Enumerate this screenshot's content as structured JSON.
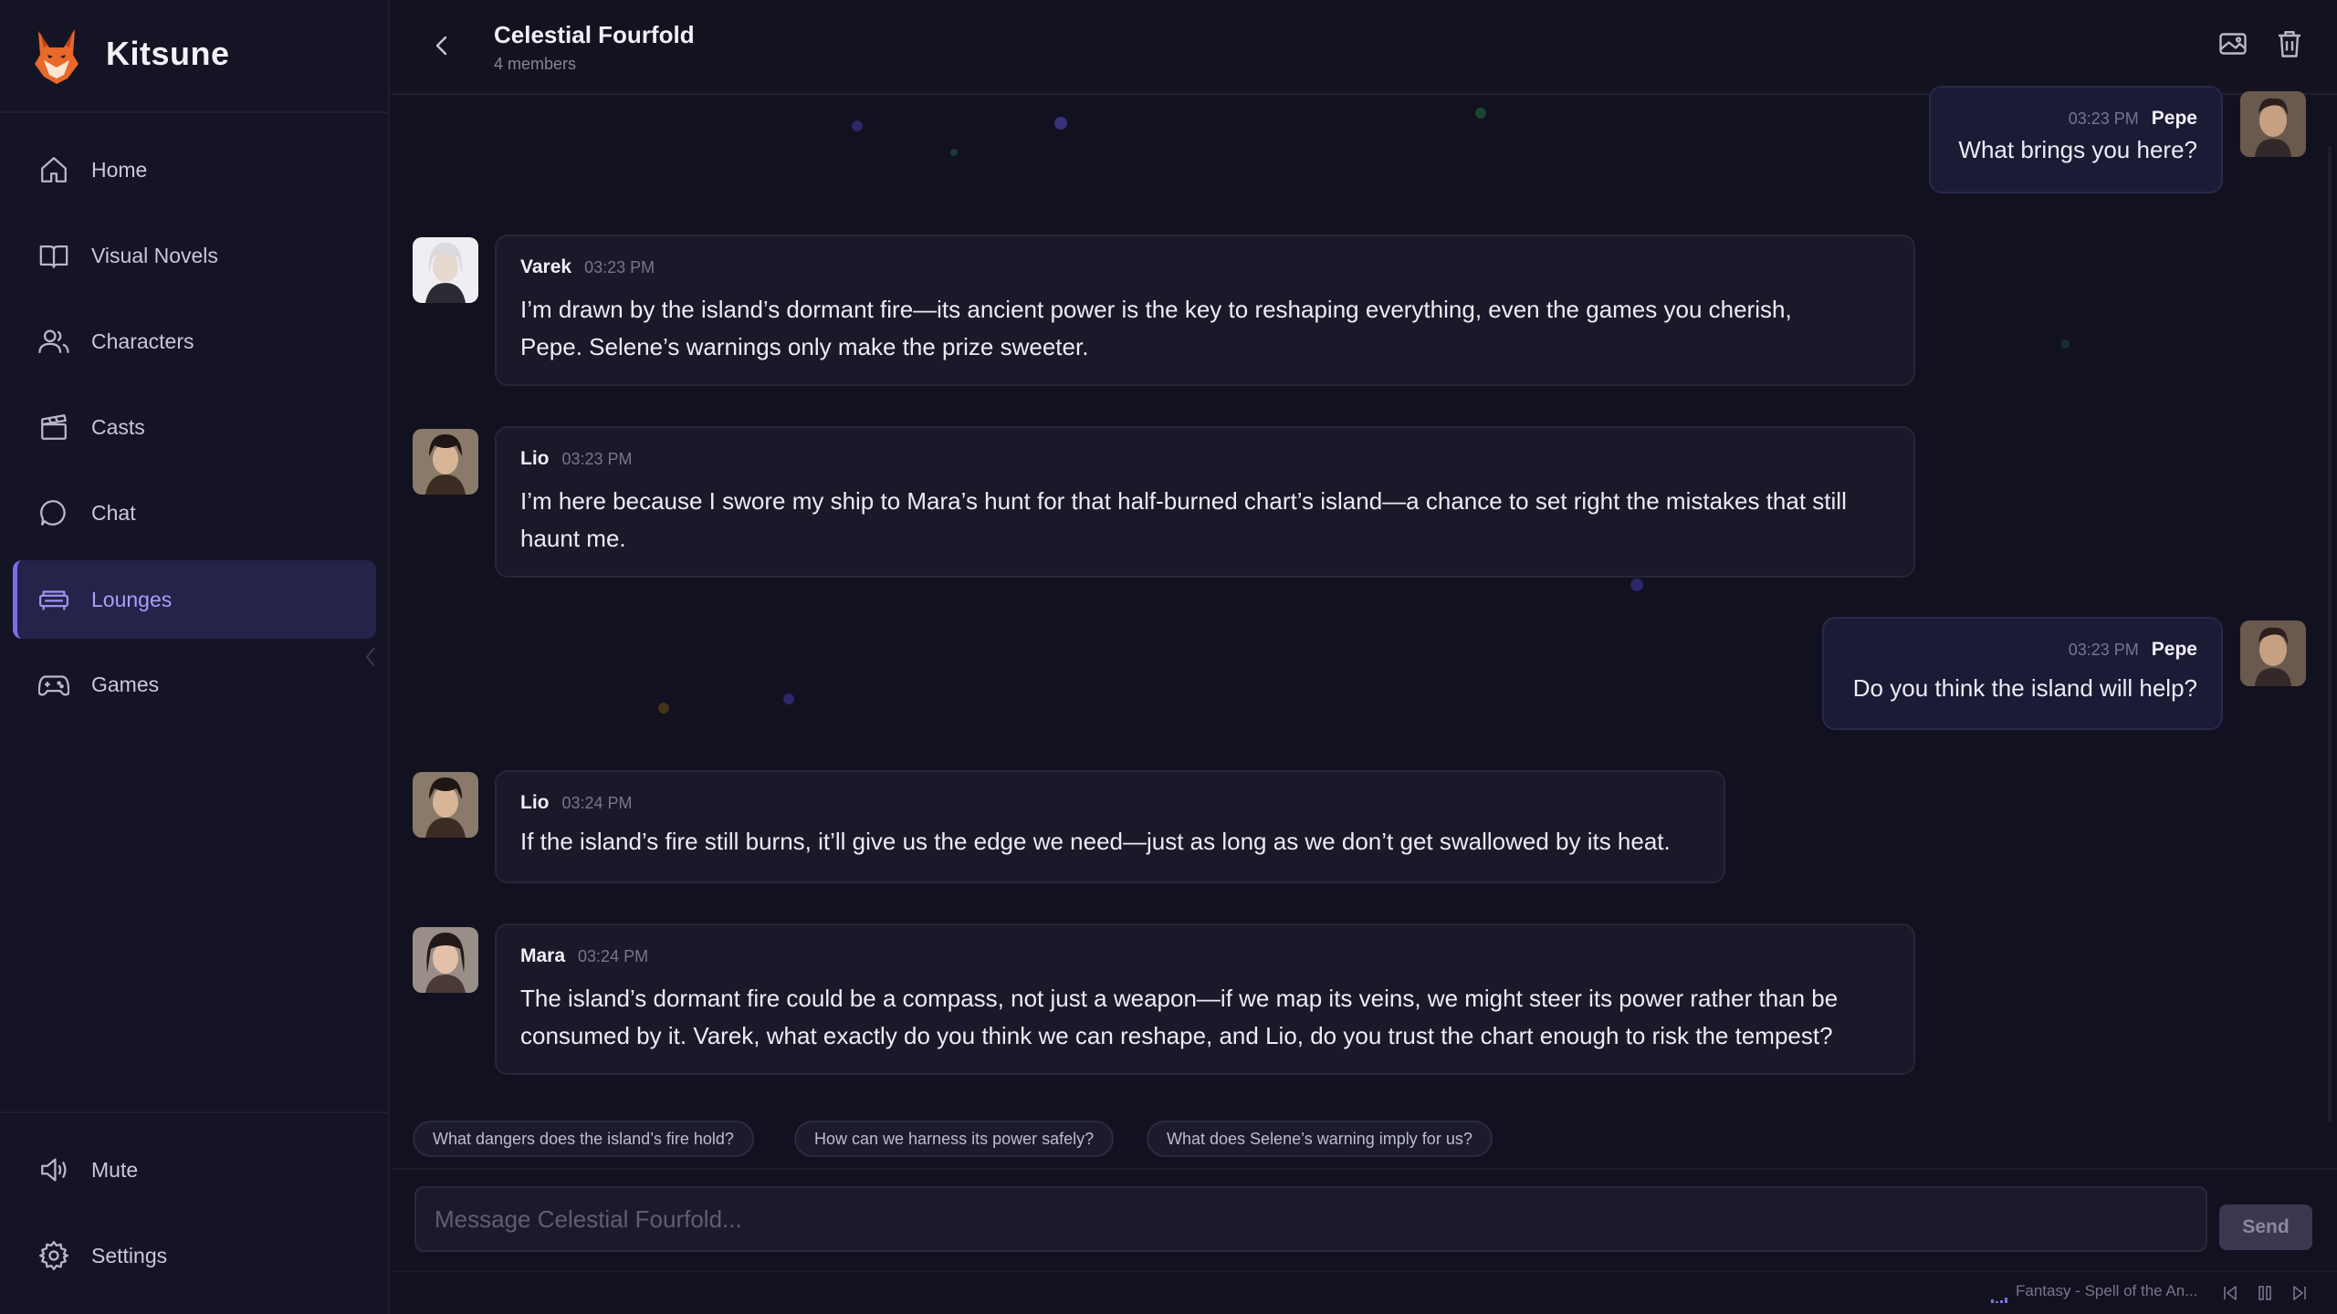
{
  "app": {
    "name": "Kitsune"
  },
  "sidebar": {
    "items": [
      {
        "label": "Home",
        "icon": "home-icon"
      },
      {
        "label": "Visual Novels",
        "icon": "book-icon"
      },
      {
        "label": "Characters",
        "icon": "users-icon"
      },
      {
        "label": "Casts",
        "icon": "clapperboard-icon"
      },
      {
        "label": "Chat",
        "icon": "chat-bubble-icon"
      },
      {
        "label": "Lounges",
        "icon": "sofa-icon",
        "active": true
      },
      {
        "label": "Games",
        "icon": "gamepad-icon"
      }
    ],
    "bottom": [
      {
        "label": "Mute",
        "icon": "speaker-icon"
      },
      {
        "label": "Settings",
        "icon": "gear-icon"
      }
    ]
  },
  "header": {
    "title": "Celestial Fourfold",
    "subtitle": "4 members"
  },
  "messages": [
    {
      "author": "Pepe",
      "time": "03:23 PM",
      "text": "What brings you here?",
      "from_user": true
    },
    {
      "author": "Varek",
      "time": "03:23 PM",
      "text_lines": [
        "I’m drawn by the island’s dormant fire—its ancient power is the key to reshaping everything, even the games you cherish,",
        "Pepe. Selene’s warnings only make the prize sweeter."
      ]
    },
    {
      "author": "Lio",
      "time": "03:23 PM",
      "text_lines": [
        "I’m here because I swore my ship to Mara’s hunt for that half-burned chart’s island—a chance to set right the mistakes that still",
        "haunt me."
      ]
    },
    {
      "author": "Pepe",
      "time": "03:23 PM",
      "text": "Do you think the island will help?",
      "from_user": true
    },
    {
      "author": "Lio",
      "time": "03:24 PM",
      "text": "If the island’s fire still burns, it’ll give us the edge we need—just as long as we don’t get swallowed by its heat."
    },
    {
      "author": "Mara",
      "time": "03:24 PM",
      "text_lines": [
        "The island’s dormant fire could be a compass, not just a weapon—if we map its veins, we might steer its power rather than be",
        "consumed by it. Varek, what exactly do you think we can reshape, and Lio, do you trust the chart enough to risk the tempest?"
      ]
    }
  ],
  "suggestions": [
    "What dangers does the island’s fire hold?",
    "How can we harness its power safely?",
    "What does Selene’s warning imply for us?"
  ],
  "composer": {
    "placeholder": "Message Celestial Fourfold...",
    "send_label": "Send"
  },
  "player": {
    "track": "Fantasy - Spell of the An..."
  },
  "colors": {
    "accent": "#7b6ee6",
    "background": "#12111f",
    "sidebar": "#151425",
    "bubble": "#1a1929",
    "user_bubble": "#1c1b36"
  }
}
